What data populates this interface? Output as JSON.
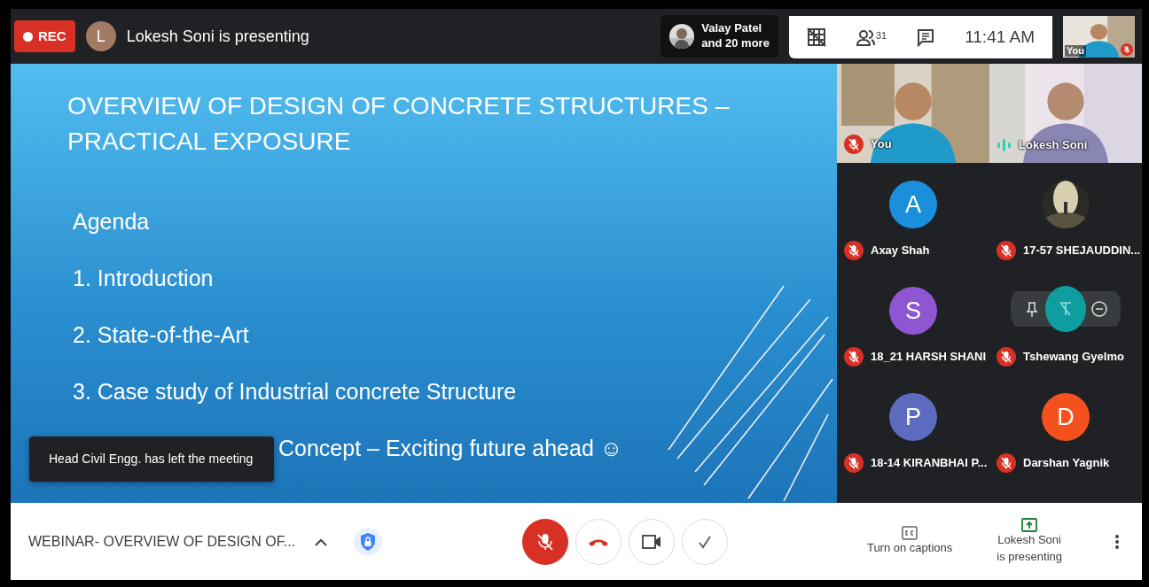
{
  "top_bar": {
    "recording": "REC",
    "presenter_initial": "L",
    "presenter_text": "Lokesh Soni is presenting",
    "viewers": {
      "name": "Valay Patel",
      "more": "and 20 more"
    },
    "participant_count": "31",
    "time": "11:41 AM",
    "self_view": {
      "label": "You",
      "muted": true
    }
  },
  "slide": {
    "title": "OVERVIEW OF DESIGN OF CONCRETE STRUCTURES – PRACTICAL EXPOSURE",
    "lines": [
      "Agenda",
      "1. Introduction",
      "2. State-of-the-Art",
      "3. Case study of Industrial concrete Structure"
    ],
    "partly_hidden_line": "Concept – Exciting future ahead ☺"
  },
  "toast": "Head Civil Engg. has left the meeting",
  "participants": [
    {
      "name": "You",
      "kind": "video",
      "muted": true,
      "hovered": false
    },
    {
      "name": "Lokesh Soni",
      "kind": "video",
      "muted": false,
      "hovered": false
    },
    {
      "name": "Axay Shah",
      "kind": "initial",
      "initial": "A",
      "color": "#1a8fdc",
      "muted": true,
      "hovered": false
    },
    {
      "name": "17-57 SHEJAUDDIN...",
      "muted": true,
      "hovered": false
    },
    {
      "name": "18_21 HARSH SHANI",
      "kind": "initial",
      "initial": "S",
      "color": "#8e57d1",
      "muted": true,
      "hovered": false
    },
    {
      "name": "Tshewang Gyelmo",
      "kind": "initial",
      "color": "#0e9ea0",
      "muted": true,
      "hovered": true
    },
    {
      "name": "18-14 KIRANBHAI P...",
      "kind": "initial",
      "initial": "P",
      "color": "#5c6bc0",
      "muted": true,
      "hovered": false
    },
    {
      "name": "Darshan Yagnik",
      "kind": "initial",
      "initial": "D",
      "color": "#f4511e",
      "muted": true,
      "hovered": false
    }
  ],
  "bottom_bar": {
    "meeting_title": "WEBINAR- OVERVIEW OF DESIGN OF...",
    "mic_muted": true,
    "captions": "Turn on captions",
    "presenting": {
      "name": "Lokesh Soni",
      "status": "is presenting"
    }
  }
}
